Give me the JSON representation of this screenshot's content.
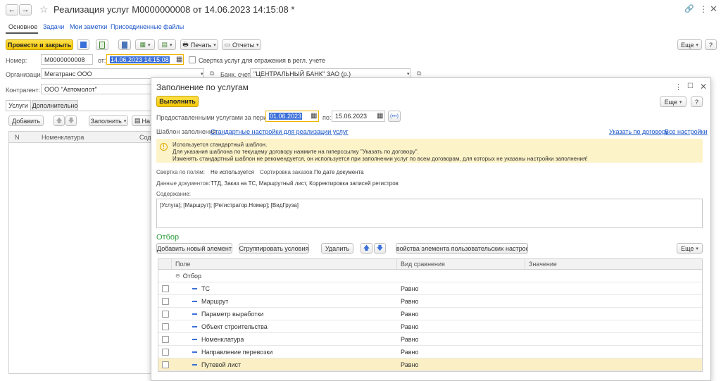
{
  "window": {
    "title": "Реализация услуг  М0000000008 от 14.06.2023 14:15:08 *",
    "colors": {
      "accent": "#f5c800",
      "link": "#1a55c8",
      "selection": "#3a6fd8",
      "hint_bg": "#fdf3c9",
      "green": "#2e9c3e"
    }
  },
  "tabs": [
    "Основное",
    "Задачи",
    "Мои заметки",
    "Присоединенные файлы"
  ],
  "toolbar": {
    "post_close": "Провести и закрыть",
    "print": "Печать",
    "reports": "Отчеты",
    "more": "Еще",
    "help": "?"
  },
  "form": {
    "number_label": "Номер:",
    "number_value": "М0000000008",
    "from_label": "от:",
    "date_value": "14.06.2023 14:15:08",
    "fold_label": "Свертка услуг для отражения в регл. учете",
    "org_label": "Организация:",
    "org_value": "Мегатранс ООО",
    "bank_label": "Банк. счет:",
    "bank_value": "\"ЦЕНТРАЛЬНЫЙ БАНК\" ЗАО (р.)",
    "contractor_label": "Контрагент:",
    "contractor_value": "ООО \"Автомолот\""
  },
  "inner_tabs": [
    "Услуги",
    "Дополнительно"
  ],
  "services_toolbar": {
    "add": "Добавить",
    "fill": "Заполнить",
    "more_short": "На"
  },
  "services_table": {
    "col_n": "N",
    "col_nom": "Номенклатура",
    "col_sod": "Соде"
  },
  "dialog": {
    "title": "Заполнение по услугам",
    "execute": "Выполнить",
    "more": "Еще",
    "help": "?",
    "period_label": "Предоставленными услугами за период с:",
    "period_from": "01.06.2023",
    "period_to_label": "по:",
    "period_to": "15.06.2023",
    "period_btn": "(•••)",
    "template_label": "Шаблон заполнения:",
    "template_link": "Стандартные настройки для реализации услуг",
    "by_contract_link": "Указать по договору",
    "all_settings_link": "Все настройки",
    "hint": [
      "Используется стандартный шаблон.",
      "Для указания шаблона по текущему договору нажмите на гиперссылку \"Указать по договору\".",
      "Изменять стандартный шаблон не рекомендуется, он используется при заполнении услуг по всем договорам, для которых не указаны настройки заполнения!"
    ],
    "fold_fields_label": "Свертка по полям:",
    "fold_fields_value": "Не используется",
    "sort_label": "Сортировка заказов:",
    "sort_value": "По дате документа",
    "doc_data_label": "Данные документов:",
    "doc_data_value": "ТТД, Заказ на ТС, Маршрутный лист, Корректировка записей регистров",
    "content_label": "Содержание:",
    "content_value": "[Услуга]; [Маршрут]; [Регистратор.Номер]; [ВидГруза]",
    "filter_title": "Отбор",
    "filter_toolbar": {
      "add": "Добавить новый элемент",
      "group": "Сгруппировать условия",
      "delete": "Удалить",
      "props": "Свойства элемента пользовательских настроек",
      "more": "Еще"
    },
    "filter_table": {
      "headers": [
        "Поле",
        "Вид сравнения",
        "Значение"
      ],
      "group_row": "Отбор",
      "rows": [
        {
          "field": "ТС",
          "cmp": "Равно"
        },
        {
          "field": "Маршрут",
          "cmp": "Равно"
        },
        {
          "field": "Параметр выработки",
          "cmp": "Равно"
        },
        {
          "field": "Объект строительства",
          "cmp": "Равно"
        },
        {
          "field": "Номенклатура",
          "cmp": "Равно"
        },
        {
          "field": "Направление перевозки",
          "cmp": "Равно"
        },
        {
          "field": "Путевой лист",
          "cmp": "Равно"
        }
      ]
    }
  }
}
